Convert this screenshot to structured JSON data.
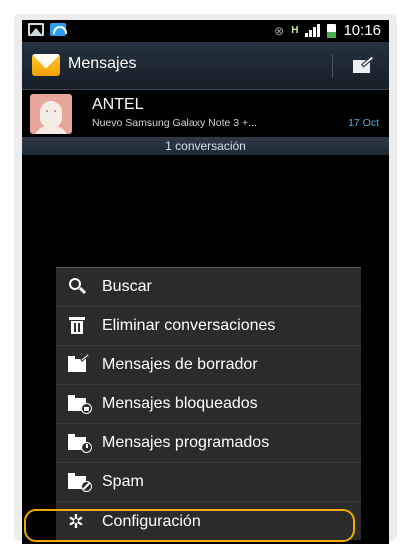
{
  "status_bar": {
    "time": "10:16",
    "network_label": "H",
    "icons": [
      "image-icon",
      "wifi-icon",
      "no-signal-icon",
      "hspa-icon",
      "signal-icon",
      "battery-icon"
    ]
  },
  "action_bar": {
    "title": "Mensajes",
    "icons": [
      "envelope-icon",
      "compose-icon"
    ]
  },
  "conversation": {
    "name": "ANTEL",
    "preview": "Nuevo Samsung Galaxy Note 3 +...",
    "date": "17 Oct"
  },
  "conversation_count": "1 conversación",
  "menu": {
    "items": [
      {
        "label": "Buscar",
        "icon": "search-icon"
      },
      {
        "label": "Eliminar conversaciones",
        "icon": "trash-icon"
      },
      {
        "label": "Mensajes de borrador",
        "icon": "draft-folder-icon"
      },
      {
        "label": "Mensajes bloqueados",
        "icon": "locked-folder-icon"
      },
      {
        "label": "Mensajes programados",
        "icon": "scheduled-folder-icon"
      },
      {
        "label": "Spam",
        "icon": "spam-folder-icon"
      },
      {
        "label": "Configuración",
        "icon": "gear-icon"
      }
    ]
  },
  "colors": {
    "highlight": "#f2a900",
    "accent_date": "#4ab3e6"
  }
}
